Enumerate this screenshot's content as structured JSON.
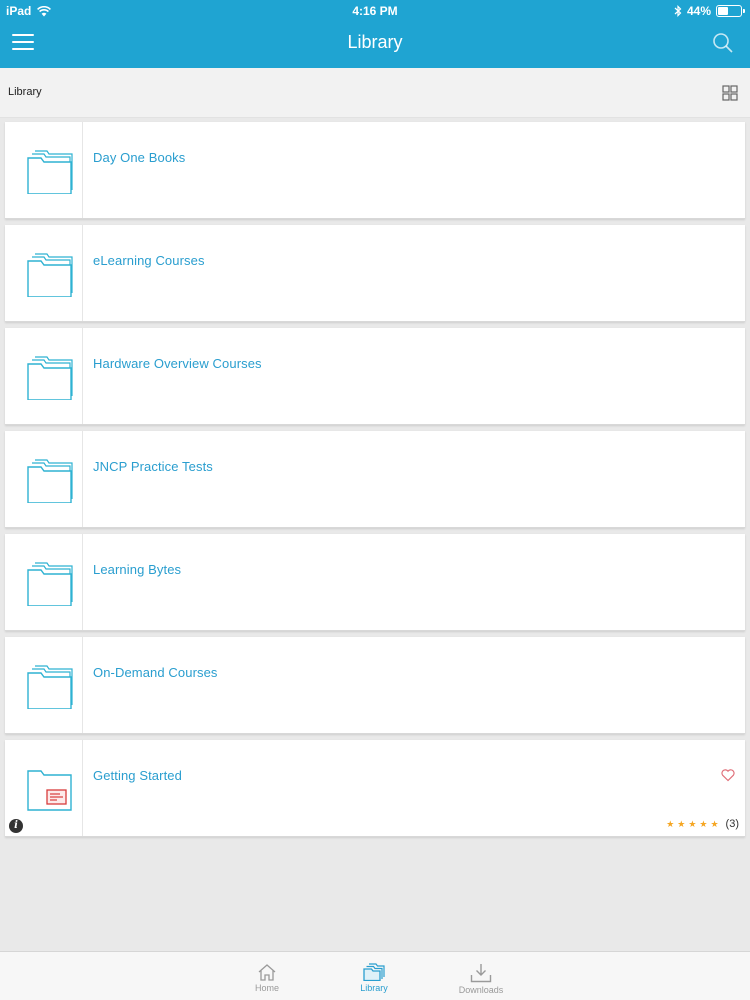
{
  "status_bar": {
    "device": "iPad",
    "time": "4:16 PM",
    "battery": "44%",
    "battery_level": 0.44
  },
  "nav": {
    "title": "Library",
    "menu_icon": "hamburger-menu-icon",
    "search_icon": "search-icon"
  },
  "subbar": {
    "breadcrumb": "Library",
    "view_icon": "grid-view-icon"
  },
  "library_items": [
    {
      "title": "Day One Books",
      "icon": "folder-icon"
    },
    {
      "title": "eLearning Courses",
      "icon": "folder-icon"
    },
    {
      "title": "Hardware Overview Courses",
      "icon": "folder-icon"
    },
    {
      "title": "JNCP Practice Tests",
      "icon": "folder-icon"
    },
    {
      "title": "Learning Bytes",
      "icon": "folder-icon"
    },
    {
      "title": "On-Demand Courses",
      "icon": "folder-icon"
    },
    {
      "title": "Getting Started",
      "icon": "folder-document-icon",
      "rating_stars": 5,
      "rating_count": "(3)",
      "favorite_icon": "heart-icon",
      "info_icon": "info-icon"
    }
  ],
  "tab_bar": {
    "tabs": [
      {
        "label": "Home",
        "icon": "home-icon",
        "active": false
      },
      {
        "label": "Library",
        "icon": "library-icon",
        "active": true
      },
      {
        "label": "Downloads",
        "icon": "download-icon",
        "active": false
      }
    ]
  },
  "colors": {
    "header": "#1fa4d2",
    "title_text": "#2a9ecf",
    "folder_stroke": "#2fb2d2",
    "star": "#f5a623",
    "heart": "#e0707a",
    "doc_red": "#d83c3c"
  }
}
